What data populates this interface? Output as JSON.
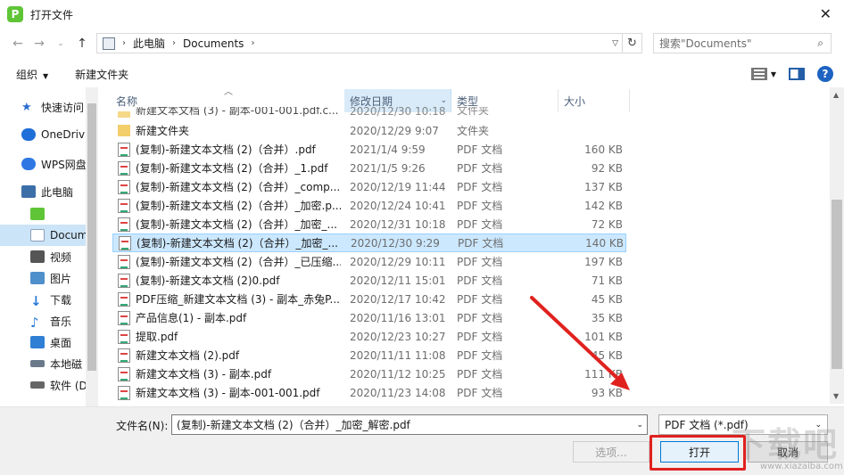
{
  "window": {
    "title": "打开文件",
    "app_icon_letter": "P"
  },
  "address": {
    "parts": [
      "此电脑",
      "Documents"
    ],
    "search_placeholder": "搜索\"Documents\""
  },
  "toolbar": {
    "organize": "组织",
    "new_folder": "新建文件夹"
  },
  "nav": [
    {
      "label": "快速访问",
      "color": "#2b6dd1"
    },
    {
      "label": "OneDriv",
      "color": "#1e6fd8"
    },
    {
      "label": "WPS网盘",
      "color": "#2f78e4"
    },
    {
      "label": "此电脑",
      "color": "#3c6fa8"
    },
    {
      "label": "",
      "color": "#5fc536"
    },
    {
      "label": "Docum",
      "color": "#8aa1b9"
    },
    {
      "label": "视频",
      "color": "#555"
    },
    {
      "label": "图片",
      "color": "#4f8fcb"
    },
    {
      "label": "下载",
      "color": "#2b7ad6"
    },
    {
      "label": "音乐",
      "color": "#2b7ad6"
    },
    {
      "label": "桌面",
      "color": "#2f7fd5"
    },
    {
      "label": "本地磁",
      "color": "#6a7a8a"
    },
    {
      "label": "软件 (D",
      "color": "#666"
    }
  ],
  "columns": {
    "name": "名称",
    "date": "修改日期",
    "type": "类型",
    "size": "大小"
  },
  "files": [
    {
      "name": "新建文件夹",
      "date": "2020/12/29 9:07",
      "type": "文件夹",
      "size": "",
      "kind": "folder"
    },
    {
      "name": "(复制)-新建文本文档 (2)（合并）.pdf",
      "date": "2021/1/4 9:59",
      "type": "PDF 文档",
      "size": "160 KB",
      "kind": "pdf"
    },
    {
      "name": "(复制)-新建文本文档 (2)（合并）_1.pdf",
      "date": "2021/1/5 9:26",
      "type": "PDF 文档",
      "size": "92 KB",
      "kind": "pdf"
    },
    {
      "name": "(复制)-新建文本文档 (2)（合并）_comp...",
      "date": "2020/12/19 11:44",
      "type": "PDF 文档",
      "size": "137 KB",
      "kind": "pdf"
    },
    {
      "name": "(复制)-新建文本文档 (2)（合并）_加密.p...",
      "date": "2020/12/24 10:41",
      "type": "PDF 文档",
      "size": "142 KB",
      "kind": "pdf"
    },
    {
      "name": "(复制)-新建文本文档 (2)（合并）_加密_...",
      "date": "2020/12/31 10:18",
      "type": "PDF 文档",
      "size": "72 KB",
      "kind": "pdf"
    },
    {
      "name": "(复制)-新建文本文档 (2)（合并）_加密_...",
      "date": "2020/12/30 9:29",
      "type": "PDF 文档",
      "size": "140 KB",
      "kind": "pdf",
      "selected": true
    },
    {
      "name": "(复制)-新建文本文档 (2)（合并）_已压缩...",
      "date": "2020/12/29 10:11",
      "type": "PDF 文档",
      "size": "197 KB",
      "kind": "pdf"
    },
    {
      "name": "(复制)-新建文本文档 (2)0.pdf",
      "date": "2020/12/11 15:01",
      "type": "PDF 文档",
      "size": "71 KB",
      "kind": "pdf"
    },
    {
      "name": "PDF压缩_新建文本文档 (3) - 副本_赤兔P...",
      "date": "2020/12/17 10:42",
      "type": "PDF 文档",
      "size": "45 KB",
      "kind": "pdf"
    },
    {
      "name": "产品信息(1) - 副本.pdf",
      "date": "2020/11/16 13:01",
      "type": "PDF 文档",
      "size": "35 KB",
      "kind": "pdf"
    },
    {
      "name": "提取.pdf",
      "date": "2020/12/23 10:27",
      "type": "PDF 文档",
      "size": "101 KB",
      "kind": "pdf"
    },
    {
      "name": "新建文本文档 (2).pdf",
      "date": "2020/11/11 11:08",
      "type": "PDF 文档",
      "size": "45 KB",
      "kind": "pdf"
    },
    {
      "name": "新建文本文档 (3) - 副本.pdf",
      "date": "2020/11/12 10:25",
      "type": "PDF 文档",
      "size": "111 KB",
      "kind": "pdf"
    },
    {
      "name": "新建文本文档 (3) - 副本-001-001.pdf",
      "date": "2020/11/23 14:08",
      "type": "PDF 文档",
      "size": "93 KB",
      "kind": "pdf"
    }
  ],
  "partial_top_row": {
    "name": "新建文本文档 (3) - 副本-001-001.pdf.c...",
    "date": "2020/12/30 10:18",
    "type": "文件夹"
  },
  "bottom": {
    "filename_label": "文件名(N):",
    "filename_value": "(复制)-新建文本文档 (2)（合并）_加密_解密.pdf",
    "filter": "PDF 文档 (*.pdf)",
    "tools_button": "选项...",
    "open_button": "打开",
    "cancel_button": "取消"
  },
  "watermark": {
    "text": "下载吧",
    "url": "www.xiazaiba.com"
  },
  "colors": {
    "selection": "#cce8ff",
    "accent": "#0078d7",
    "annotation": "#e0221f"
  }
}
